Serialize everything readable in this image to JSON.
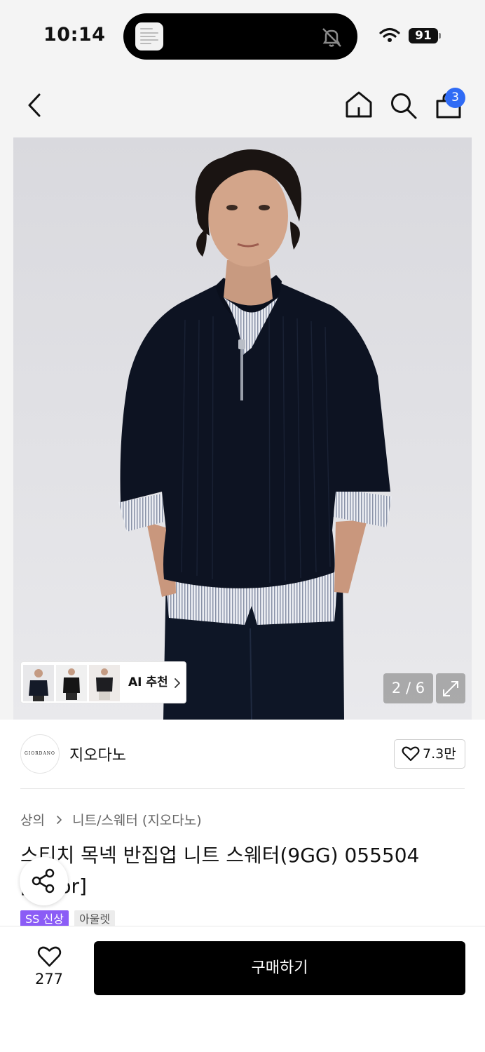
{
  "status_bar": {
    "time": "10:14",
    "battery": "91",
    "icons": [
      "app-preview-icon",
      "bell-slash-icon",
      "wifi-icon",
      "battery-icon"
    ]
  },
  "nav": {
    "cart_count": "3",
    "icons": [
      "back-icon",
      "home-icon",
      "search-icon",
      "cart-icon"
    ]
  },
  "gallery": {
    "ai_recommend_label": "AI 추천",
    "counter": "2 / 6",
    "current_index": 2,
    "total": 6
  },
  "brand": {
    "logo_text": "GIORDANO",
    "name": "지오다노",
    "likes": "7.3만"
  },
  "product": {
    "breadcrumb": [
      "상의",
      "니트/스웨터 (지오다노)"
    ],
    "title": "스티치 목넥 반집업 니트 스웨터(9GG) 055504 [Color]",
    "tags": [
      "SS 신상",
      "아울렛"
    ]
  },
  "bottom": {
    "wish_count": "277",
    "buy_label": "구매하기"
  },
  "colors": {
    "badge": "#2f6bf5",
    "tag_new": "#8b5cf6",
    "buy_button": "#000000"
  }
}
